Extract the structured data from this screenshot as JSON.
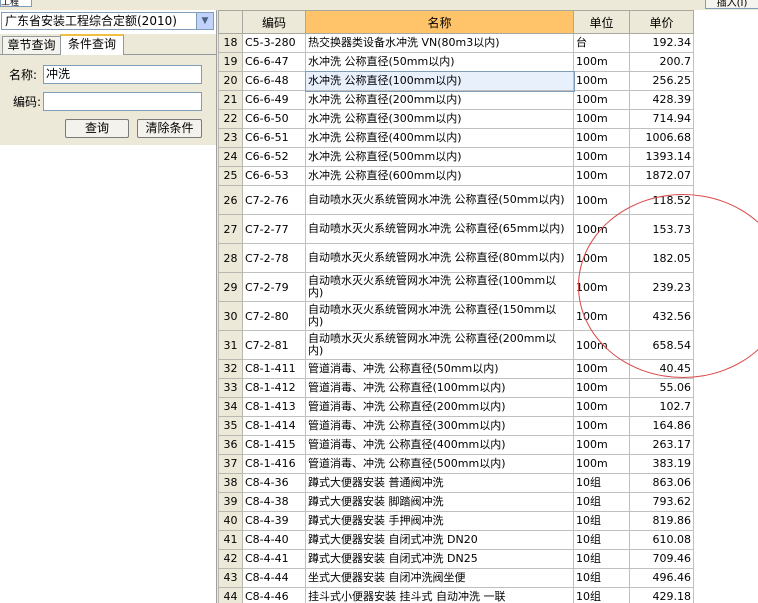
{
  "top": {
    "left_tab": "工程",
    "right_button": "插入(I)"
  },
  "left_panel": {
    "quota_select": "广东省安装工程综合定额(2010)",
    "tabs": [
      "章节查询",
      "条件查询"
    ],
    "name_label": "名称:",
    "name_value": "冲洗",
    "code_label": "编码:",
    "code_value": "",
    "query_button": "查询",
    "clear_button": "清除条件"
  },
  "grid": {
    "columns": [
      "编码",
      "名称",
      "单位",
      "单价"
    ],
    "rows": [
      {
        "no": "18",
        "code": "C5-3-280",
        "name": "热交换器类设备水冲洗 VN(80m3以内)",
        "unit": "台",
        "price": "192.34"
      },
      {
        "no": "19",
        "code": "C6-6-47",
        "name": "水冲洗 公称直径(50mm以内)",
        "unit": "100m",
        "price": "200.7"
      },
      {
        "no": "20",
        "code": "C6-6-48",
        "name": "水冲洗 公称直径(100mm以内)",
        "unit": "100m",
        "price": "256.25"
      },
      {
        "no": "21",
        "code": "C6-6-49",
        "name": "水冲洗 公称直径(200mm以内)",
        "unit": "100m",
        "price": "428.39"
      },
      {
        "no": "22",
        "code": "C6-6-50",
        "name": "水冲洗 公称直径(300mm以内)",
        "unit": "100m",
        "price": "714.94"
      },
      {
        "no": "23",
        "code": "C6-6-51",
        "name": "水冲洗 公称直径(400mm以内)",
        "unit": "100m",
        "price": "1006.68"
      },
      {
        "no": "24",
        "code": "C6-6-52",
        "name": "水冲洗 公称直径(500mm以内)",
        "unit": "100m",
        "price": "1393.14"
      },
      {
        "no": "25",
        "code": "C6-6-53",
        "name": "水冲洗 公称直径(600mm以内)",
        "unit": "100m",
        "price": "1872.07"
      },
      {
        "no": "26",
        "code": "C7-2-76",
        "name": "自动喷水灭火系统管网水冲洗 公称直径(50mm以内)",
        "unit": "100m",
        "price": "118.52"
      },
      {
        "no": "27",
        "code": "C7-2-77",
        "name": "自动喷水灭火系统管网水冲洗 公称直径(65mm以内)",
        "unit": "100m",
        "price": "153.73"
      },
      {
        "no": "28",
        "code": "C7-2-78",
        "name": "自动喷水灭火系统管网水冲洗 公称直径(80mm以内)",
        "unit": "100m",
        "price": "182.05"
      },
      {
        "no": "29",
        "code": "C7-2-79",
        "name": "自动喷水灭火系统管网水冲洗 公称直径(100mm以内)",
        "unit": "100m",
        "price": "239.23"
      },
      {
        "no": "30",
        "code": "C7-2-80",
        "name": "自动喷水灭火系统管网水冲洗 公称直径(150mm以内)",
        "unit": "100m",
        "price": "432.56"
      },
      {
        "no": "31",
        "code": "C7-2-81",
        "name": "自动喷水灭火系统管网水冲洗 公称直径(200mm以内)",
        "unit": "100m",
        "price": "658.54"
      },
      {
        "no": "32",
        "code": "C8-1-411",
        "name": "管道消毒、冲洗 公称直径(50mm以内)",
        "unit": "100m",
        "price": "40.45"
      },
      {
        "no": "33",
        "code": "C8-1-412",
        "name": "管道消毒、冲洗 公称直径(100mm以内)",
        "unit": "100m",
        "price": "55.06"
      },
      {
        "no": "34",
        "code": "C8-1-413",
        "name": "管道消毒、冲洗 公称直径(200mm以内)",
        "unit": "100m",
        "price": "102.7"
      },
      {
        "no": "35",
        "code": "C8-1-414",
        "name": "管道消毒、冲洗 公称直径(300mm以内)",
        "unit": "100m",
        "price": "164.86"
      },
      {
        "no": "36",
        "code": "C8-1-415",
        "name": "管道消毒、冲洗 公称直径(400mm以内)",
        "unit": "100m",
        "price": "263.17"
      },
      {
        "no": "37",
        "code": "C8-1-416",
        "name": "管道消毒、冲洗 公称直径(500mm以内)",
        "unit": "100m",
        "price": "383.19"
      },
      {
        "no": "38",
        "code": "C8-4-36",
        "name": "蹲式大便器安装 普通阀冲洗",
        "unit": "10组",
        "price": "863.06"
      },
      {
        "no": "39",
        "code": "C8-4-38",
        "name": "蹲式大便器安装 脚踏阀冲洗",
        "unit": "10组",
        "price": "793.62"
      },
      {
        "no": "40",
        "code": "C8-4-39",
        "name": "蹲式大便器安装 手押阀冲洗",
        "unit": "10组",
        "price": "819.86"
      },
      {
        "no": "41",
        "code": "C8-4-40",
        "name": "蹲式大便器安装 自闭式冲洗 DN20",
        "unit": "10组",
        "price": "610.08"
      },
      {
        "no": "42",
        "code": "C8-4-41",
        "name": "蹲式大便器安装 自闭式冲洗 DN25",
        "unit": "10组",
        "price": "709.46"
      },
      {
        "no": "43",
        "code": "C8-4-44",
        "name": "坐式大便器安装 自闭冲洗阀坐便",
        "unit": "10组",
        "price": "496.46"
      },
      {
        "no": "44",
        "code": "C8-4-46",
        "name": "挂斗式小便器安装 挂斗式 自动冲洗 一联",
        "unit": "10组",
        "price": "429.18"
      }
    ],
    "selected_row": "20"
  },
  "colors": {
    "header_highlight": "#ffc46a",
    "annotation_circle": "#d94848",
    "selection": "#e8f0fc"
  }
}
